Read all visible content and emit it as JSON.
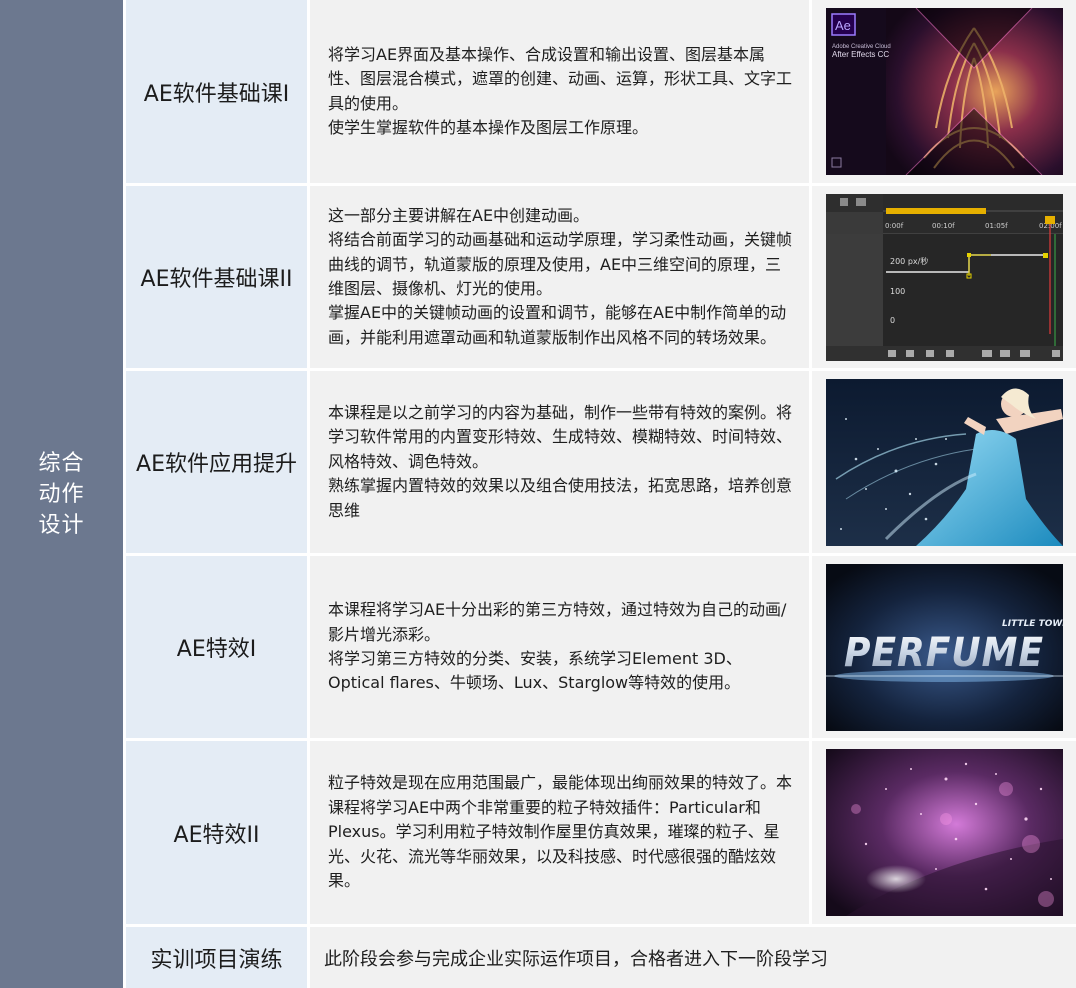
{
  "category": "综合动作设计",
  "rows": [
    {
      "title": "AE软件基础课I",
      "desc": "将学习AE界面及基本操作、合成设置和输出设置、图层基本属性、图层混合模式，遮罩的创建、动画、运算，形状工具、文字工具的使用。\n使学生掌握软件的基本操作及图层工作原理。",
      "thumb": {
        "logo": "Ae",
        "brand": "Adobe Creative Cloud",
        "product": "After Effects CC"
      }
    },
    {
      "title": "AE软件基础课II",
      "desc": "这一部分主要讲解在AE中创建动画。\n将结合前面学习的动画基础和运动学原理，学习柔性动画，关键帧曲线的调节，轨道蒙版的原理及使用，AE中三维空间的原理，三维图层、摄像机、灯光的使用。\n掌握AE中的关键帧动画的设置和调节，能够在AE中制作简单的动画，并能利用遮罩动画和轨道蒙版制作出风格不同的转场效果。",
      "thumb": {
        "t0": "0:00f",
        "t1": "00:10f",
        "t2": "01:05f",
        "t3": "02:00f",
        "speed": "200 px/秒",
        "v100": "100",
        "v0": "0"
      }
    },
    {
      "title": "AE软件应用提升",
      "desc": "本课程是以之前学习的内容为基础，制作一些带有特效的案例。将学习软件常用的内置变形特效、生成特效、模糊特效、时间特效、风格特效、调色特效。\n熟练掌握内置特效的效果以及组合使用技法，拓宽思路，培养创意思维",
      "thumb": {}
    },
    {
      "title": "AE特效I",
      "desc": "本课程将学习AE十分出彩的第三方特效，通过特效为自己的动画/影片增光添彩。\n将学习第三方特效的分类、安装，系统学习Element 3D、Optical flares、牛顿场、Lux、Starglow等特效的使用。",
      "thumb": {
        "small": "LITTLE TOWN",
        "big": "PERFUME"
      }
    },
    {
      "title": "AE特效II",
      "desc": "粒子特效是现在应用范围最广，最能体现出绚丽效果的特效了。本课程将学习AE中两个非常重要的粒子特效插件：Particular和Plexus。学习利用粒子特效制作屋里仿真效果，璀璨的粒子、星光、火花、流光等华丽效果，以及科技感、时代感很强的酷炫效果。",
      "thumb": {}
    }
  ],
  "practice": {
    "title": "实训项目演练",
    "desc": "此阶段会参与完成企业实际运作项目，合格者进入下一阶段学习"
  },
  "colors": {
    "sidebar": "#6c788f",
    "title_bg": "#e4ecf5",
    "desc_bg": "#f1f1f1",
    "ae_purple": "#9b7cff"
  }
}
